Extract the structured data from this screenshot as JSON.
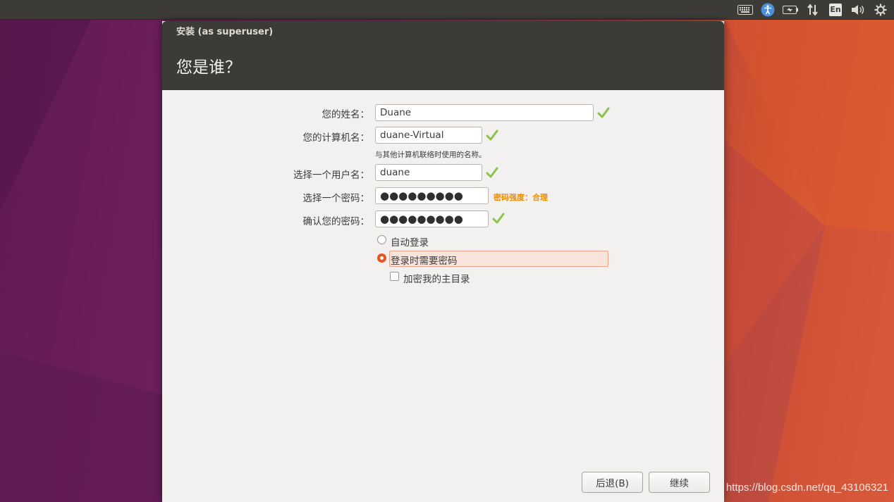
{
  "top_panel": {
    "indicators": [
      "keyboard-icon",
      "accessibility-icon",
      "battery-icon",
      "network-icon",
      "input-method-icon",
      "volume-icon",
      "settings-gear-icon"
    ],
    "input_method_label": "En"
  },
  "window": {
    "title": "安装 (as superuser)",
    "heading": "您是谁？"
  },
  "form": {
    "name": {
      "label": "您的姓名：",
      "value": "Duane"
    },
    "computer_name": {
      "label": "您的计算机名：",
      "value": "duane-Virtual",
      "hint": "与其他计算机联络时使用的名称。"
    },
    "username": {
      "label": "选择一个用户名：",
      "value": "duane"
    },
    "password": {
      "label": "选择一个密码：",
      "value": "●●●●●●●●●",
      "strength": "密码强度：合理"
    },
    "confirm_password": {
      "label": "确认您的密码：",
      "value": "●●●●●●●●●"
    }
  },
  "login_options": {
    "auto_login": {
      "label": "自动登录",
      "selected": false
    },
    "require_password": {
      "label": "登录时需要密码",
      "selected": true
    },
    "encrypt_home": {
      "label": "加密我的主目录",
      "checked": false
    }
  },
  "buttons": {
    "back": "后退(B)",
    "continue": "继续"
  },
  "watermark": "https://blog.csdn.net/qq_43106321",
  "colors": {
    "accent": "#e95420",
    "check_green": "#8bc34a",
    "strength_orange": "#f08c00",
    "panel_dark": "#3c3b37"
  }
}
